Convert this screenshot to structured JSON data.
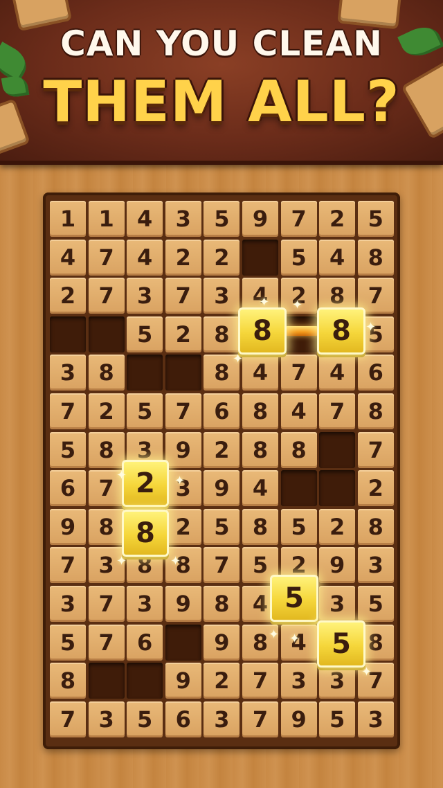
{
  "banner": {
    "line1": "CAN YOU CLEAN",
    "line2": "THEM ALL?"
  },
  "grid": {
    "rows": [
      [
        "1",
        "1",
        "4",
        "3",
        "5",
        "9",
        "7",
        "2",
        "5"
      ],
      [
        "4",
        "7",
        "4",
        "2",
        "2",
        "",
        "5",
        "4",
        "8"
      ],
      [
        "2",
        "7",
        "3",
        "7",
        "3",
        "4",
        "2",
        "8",
        "7"
      ],
      [
        "",
        "",
        "5",
        "2",
        "8",
        "8",
        "",
        "8",
        "5"
      ],
      [
        "3",
        "8",
        "",
        "",
        "8",
        "4",
        "7",
        "4",
        "6"
      ],
      [
        "7",
        "2",
        "5",
        "7",
        "6",
        "8",
        "4",
        "7",
        "8"
      ],
      [
        "5",
        "8",
        "3",
        "9",
        "2",
        "8",
        "8",
        "",
        "7"
      ],
      [
        "6",
        "7",
        "2",
        "3",
        "9",
        "4",
        "",
        "",
        "2"
      ],
      [
        "9",
        "8",
        "8",
        "2",
        "5",
        "8",
        "5",
        "2",
        "8"
      ],
      [
        "7",
        "3",
        "8",
        "8",
        "7",
        "5",
        "2",
        "9",
        "3"
      ],
      [
        "3",
        "7",
        "3",
        "9",
        "8",
        "4",
        "5",
        "3",
        "5"
      ],
      [
        "5",
        "7",
        "6",
        "",
        "9",
        "8",
        "4",
        "5",
        "8"
      ],
      [
        "8",
        "",
        "",
        "9",
        "2",
        "7",
        "3",
        "3",
        "7"
      ],
      [
        "7",
        "3",
        "5",
        "6",
        "3",
        "7",
        "9",
        "5",
        "3"
      ]
    ]
  },
  "highlights": [
    {
      "value": "8",
      "pair": "a"
    },
    {
      "value": "8",
      "pair": "a"
    },
    {
      "value": "2",
      "pair": "b"
    },
    {
      "value": "8",
      "pair": "b"
    },
    {
      "value": "5",
      "pair": "c"
    },
    {
      "value": "5",
      "pair": "c"
    }
  ],
  "colors": {
    "highlight": "#f5d63a",
    "board": "#5a2e12",
    "tile": "#e0ab6a",
    "banner": "#6b2c1a"
  }
}
